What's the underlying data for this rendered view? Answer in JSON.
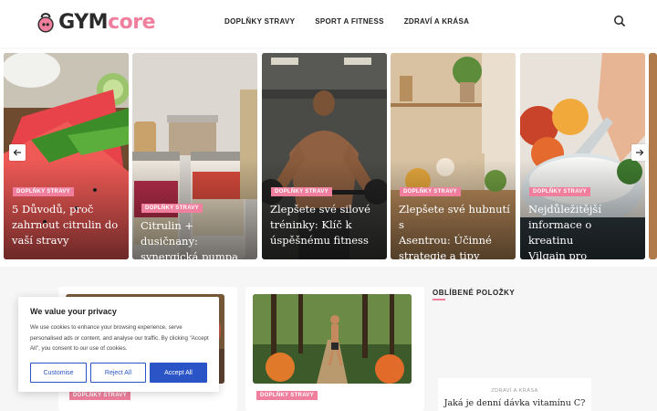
{
  "brand": {
    "gym": "GYM",
    "core": "core",
    "accent": "#ef7f9d"
  },
  "nav": {
    "items": [
      {
        "label": "DOPLŇKY STRAVY"
      },
      {
        "label": "SPORT A FITNESS"
      },
      {
        "label": "ZDRAVÍ A KRÁSA"
      }
    ],
    "search_icon": "search-icon"
  },
  "slider": {
    "slides": [
      {
        "badge": "DOPLŇKY STRAVY",
        "title_lines": [
          "5 Důvodů, proč",
          "zahrnout citrulin do",
          "vaší stravy"
        ]
      },
      {
        "badge": "DOPLŇKY STRAVY",
        "title_lines": [
          "Citrulin + dusičnany:",
          "synergická pumpa"
        ]
      },
      {
        "badge": "DOPLŇKY STRAVY",
        "title_lines": [
          "Zlepšete své silové",
          "tréninky: Klíč k",
          "úspěšnému fitness"
        ]
      },
      {
        "badge": "DOPLŇKY STRAVY",
        "title_lines": [
          "Zlepšete své hubnutí s",
          "Asentrou: Účinné",
          "strategie a tipy"
        ]
      },
      {
        "badge": "DOPLŇKY STRAVY",
        "title_lines": [
          "Nejdůležitější",
          "informace o kreatinu",
          "Vilgain pro sportovce"
        ]
      }
    ],
    "prev_icon": "arrow-left-icon",
    "next_icon": "arrow-right-icon"
  },
  "cards": [
    {
      "badge": "DOPLŇKY STRAVY"
    },
    {
      "badge": "DOPLŇKY STRAVY"
    }
  ],
  "sidebar": {
    "title": "OBLÍBENÉ POLOŽKY",
    "post": {
      "category": "ZDRAVÍ A KRÁSA",
      "title": "Jaká je denní dávka vitamínu C?"
    }
  },
  "cookie": {
    "title": "We value your privacy",
    "text": "We use cookies to enhance your browsing experience, serve personalised ads or content, and analyse our traffic. By clicking \"Accept All\", you consent to our use of cookies.",
    "customise": "Customise",
    "reject": "Reject All",
    "accept": "Accept All",
    "button_color": "#2b55c7"
  }
}
